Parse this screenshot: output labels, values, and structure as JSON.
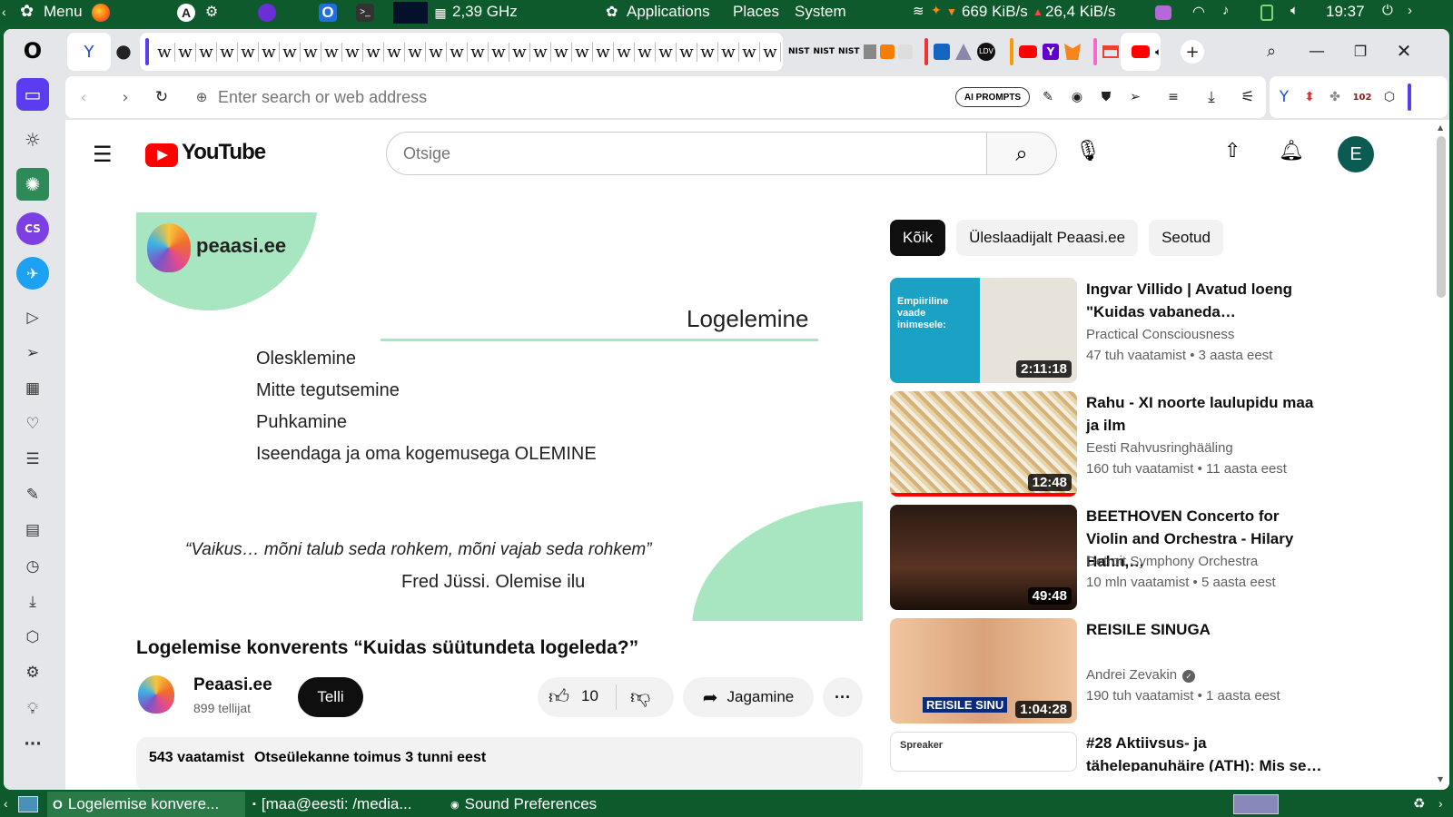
{
  "system_top": {
    "menu_label": "Menu",
    "cpu_freq": "2,39 GHz",
    "applications": "Applications",
    "places": "Places",
    "system": "System",
    "net_down": "669 KiB/s",
    "net_up": "26,4 KiB/s",
    "clock": "19:37"
  },
  "system_bottom": {
    "tasks": [
      "Logelemise konvere...",
      "[maa@eesti: /media...",
      "Sound Preferences"
    ]
  },
  "browser": {
    "address_placeholder": "Enter search or web address",
    "ai_prompts": "AI PROMPTS",
    "ext_badge": "102",
    "bookmark_glyph": "w"
  },
  "youtube": {
    "logo_text": "YouTube",
    "search_placeholder": "Otsige",
    "avatar_letter": "E",
    "chips": [
      "Kõik",
      "Üleslaadijalt Peaasi.ee",
      "Seotud"
    ],
    "video": {
      "title": "Logelemise konverents “Kuidas süütundeta logeleda?”",
      "channel": "Peaasi.ee",
      "subscribers": "899 tellijat",
      "subscribe_label": "Telli",
      "likes": "10",
      "share_label": "Jagamine",
      "views": "543 vaatamist",
      "streamed": "Otseülekanne toimus 3 tunni eest"
    },
    "slide": {
      "brand": "peaasi.ee",
      "heading": "Logelemine",
      "items": [
        "Olesklemine",
        "Mitte tegutsemine",
        "Puhkamine",
        "Iseendaga ja oma kogemusega OLEMINE"
      ],
      "quote": "“Vaikus… mõni talub seda rohkem, mõni vajab seda rohkem”",
      "attribution": "Fred Jüssi. Olemise ilu"
    },
    "recommendations": [
      {
        "title": "Ingvar Villido | Avatud loeng \"Kuidas vabaneda…",
        "channel": "Practical Consciousness",
        "views": "47 tuh vaatamist",
        "age": "3 aasta eest",
        "duration": "2:11:18",
        "thumb_text": "Empiiriline vaade inimesele:"
      },
      {
        "title": "Rahu - XI noorte laulupidu maa ja ilm",
        "channel": "Eesti Rahvusringhääling",
        "views": "160 tuh vaatamist",
        "age": "11 aasta eest",
        "duration": "12:48"
      },
      {
        "title": "BEETHOVEN Concerto for Violin and Orchestra - Hilary Hahn,…",
        "channel": "Detroit Symphony Orchestra",
        "views": "10 mln vaatamist",
        "age": "5 aasta eest",
        "duration": "49:48"
      },
      {
        "title": "REISILE SINUGA",
        "channel": "Andrei Zevakin",
        "views": "190 tuh vaatamist",
        "age": "1 aasta eest",
        "duration": "1:04:28",
        "verified": true,
        "thumb_text": "REISILE SINU"
      },
      {
        "title": "#28 Aktiivsus- ja tähelepanuhäire (ATH): Mis se…",
        "channel": "",
        "views": "",
        "age": "",
        "duration": "",
        "thumb_text": "Spreaker"
      }
    ]
  }
}
